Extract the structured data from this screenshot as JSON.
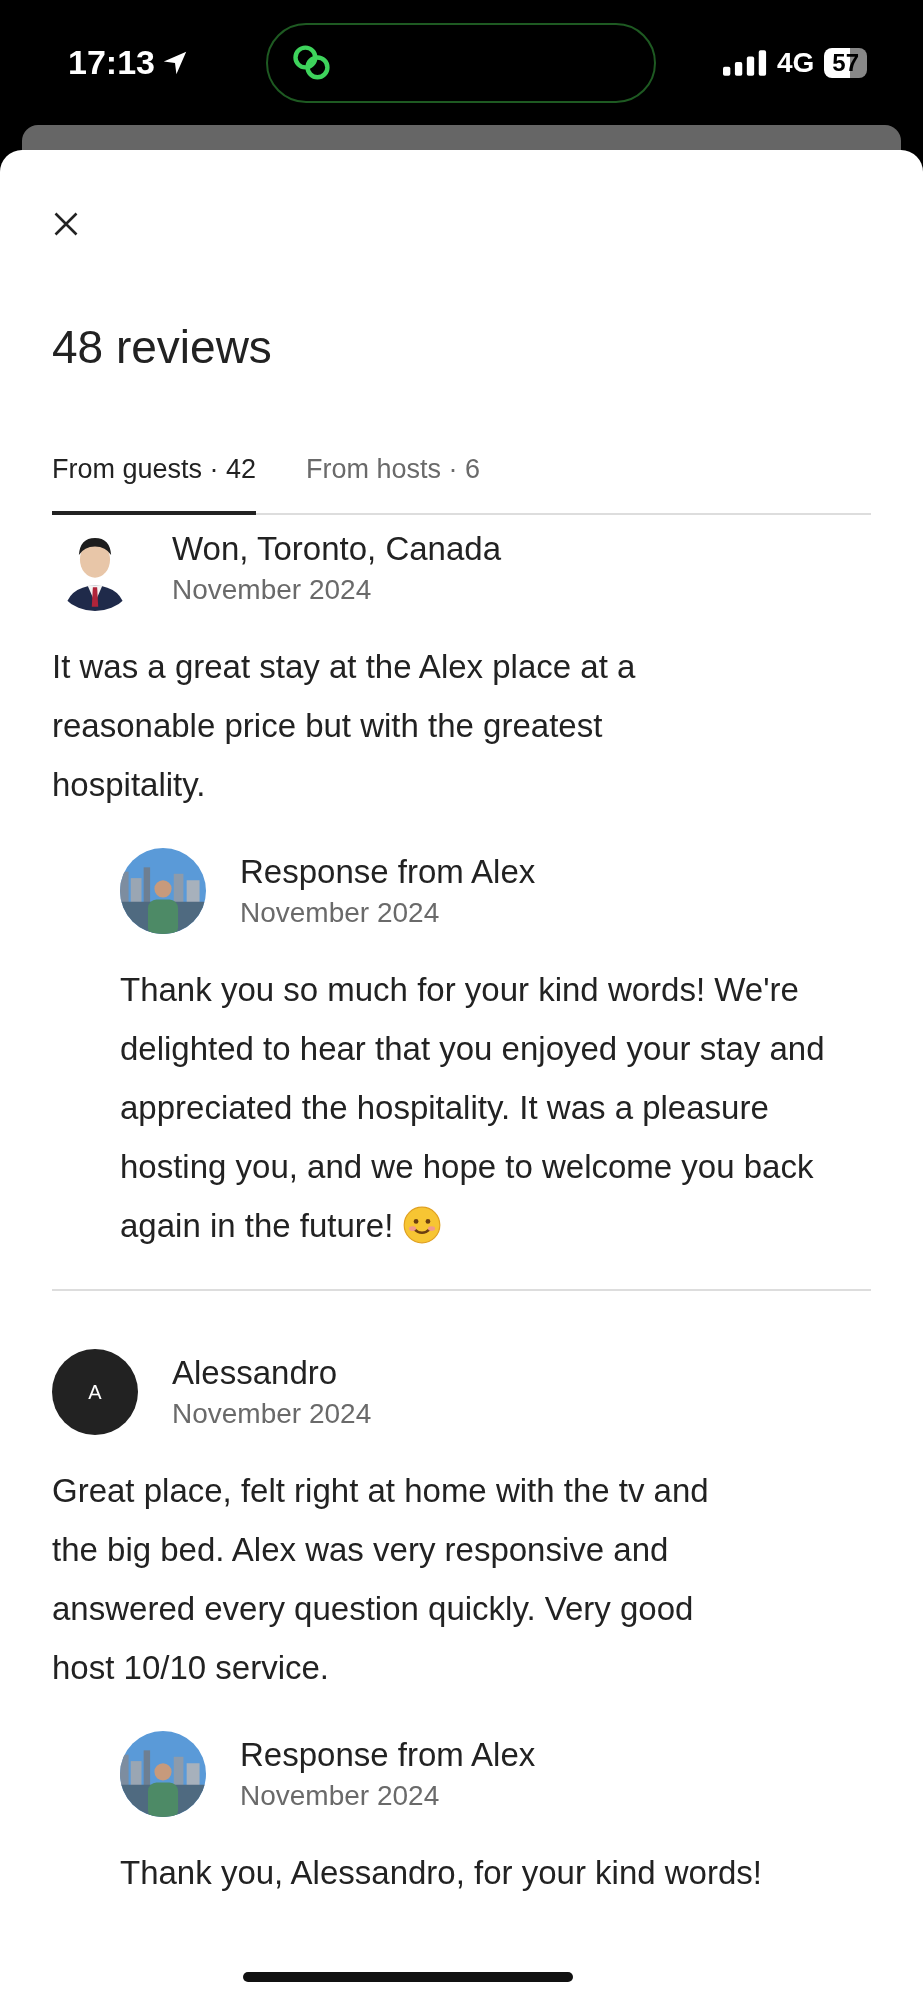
{
  "status_bar": {
    "time": "17:13",
    "network": "4G",
    "battery": "57"
  },
  "title": "48 reviews",
  "tabs": [
    {
      "label": "From guests · 42",
      "selected": true
    },
    {
      "label": "From hosts · 6",
      "selected": false
    }
  ],
  "reviews": [
    {
      "name": "Won, Toronto, Canada",
      "date": "November 2024",
      "text": "It was a great stay at the Alex place at a reasonable price but with the greatest hospitality.",
      "response": {
        "title": "Response from Alex",
        "date": "November 2024",
        "text": "Thank you so much for your kind words! We're delighted to hear that you enjoyed your stay and appreciated the hospitality. It was a pleasure hosting you, and we hope to welcome you back again in the future!",
        "emoji": true
      }
    },
    {
      "avatar": {
        "kind": "initial",
        "initial": "A"
      },
      "name": "Alessandro",
      "date": "November 2024",
      "text": "Great place, felt right at home with the tv and the big bed. Alex was very responsive and answered every question quickly. Very good host 10/10 service.",
      "response": {
        "title": "Response from Alex",
        "date": "November 2024",
        "text": "Thank you, Alessandro, for your kind words!",
        "emoji": false
      }
    }
  ]
}
